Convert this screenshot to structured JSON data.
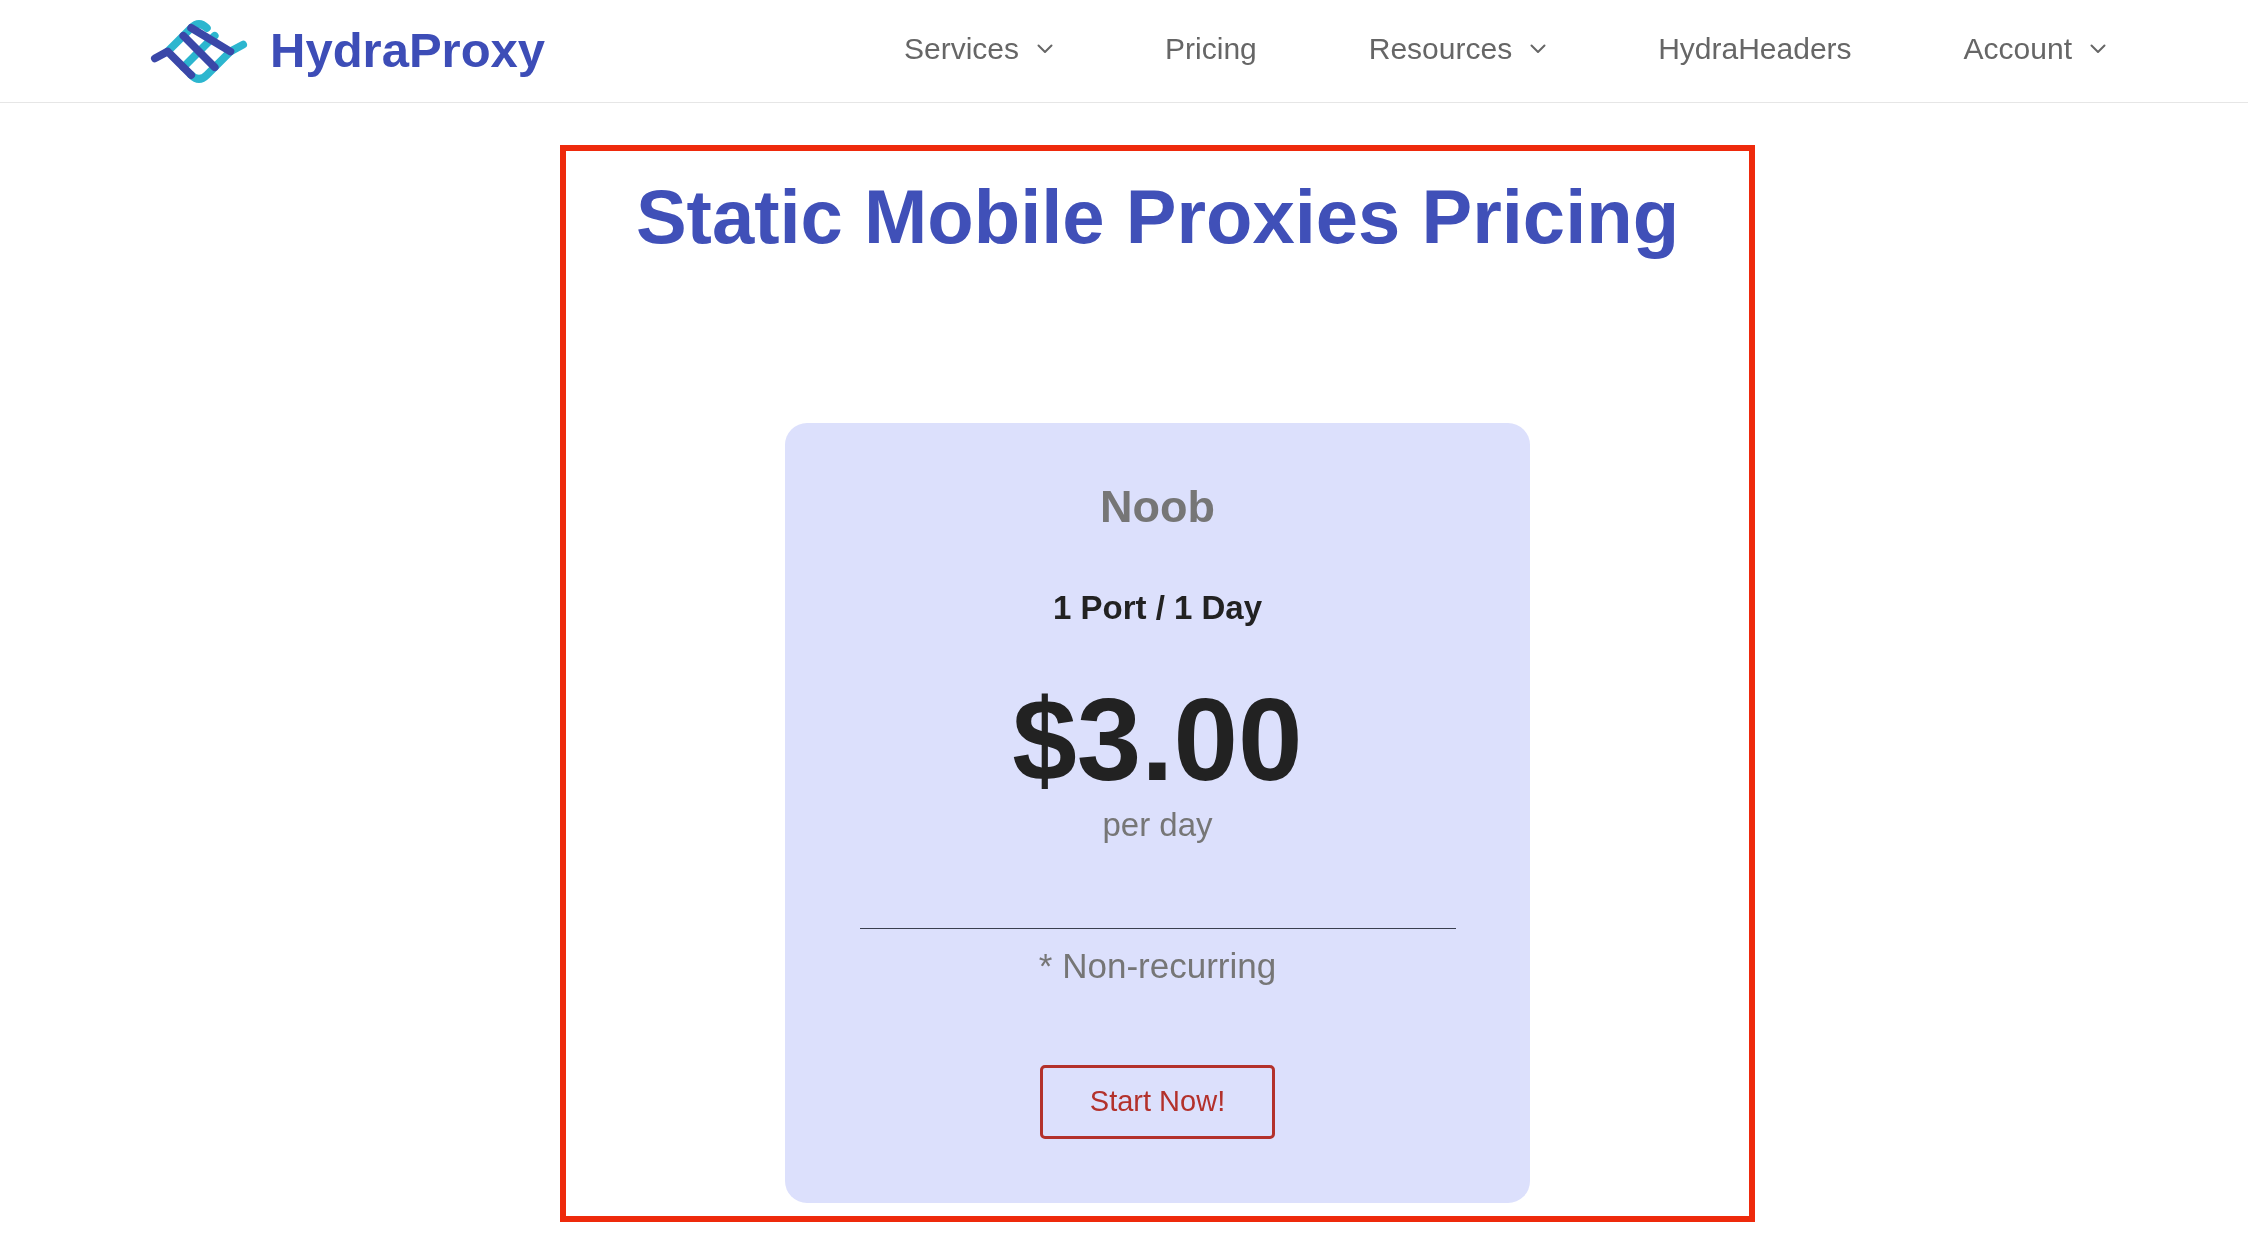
{
  "header": {
    "logo": {
      "text": "HydraProxy"
    },
    "nav": [
      {
        "label": "Services",
        "dropdown": true
      },
      {
        "label": "Pricing",
        "dropdown": false
      },
      {
        "label": "Resources",
        "dropdown": true
      },
      {
        "label": "HydraHeaders",
        "dropdown": false
      },
      {
        "label": "Account",
        "dropdown": true
      }
    ]
  },
  "main": {
    "highlighted": true,
    "title": "Static Mobile Proxies Pricing",
    "plans": [
      {
        "name": "Noob",
        "quota": "1 Port / 1 Day",
        "price": "$3.00",
        "period": "per day",
        "note": "* Non-recurring",
        "button": "Start Now!"
      }
    ]
  }
}
